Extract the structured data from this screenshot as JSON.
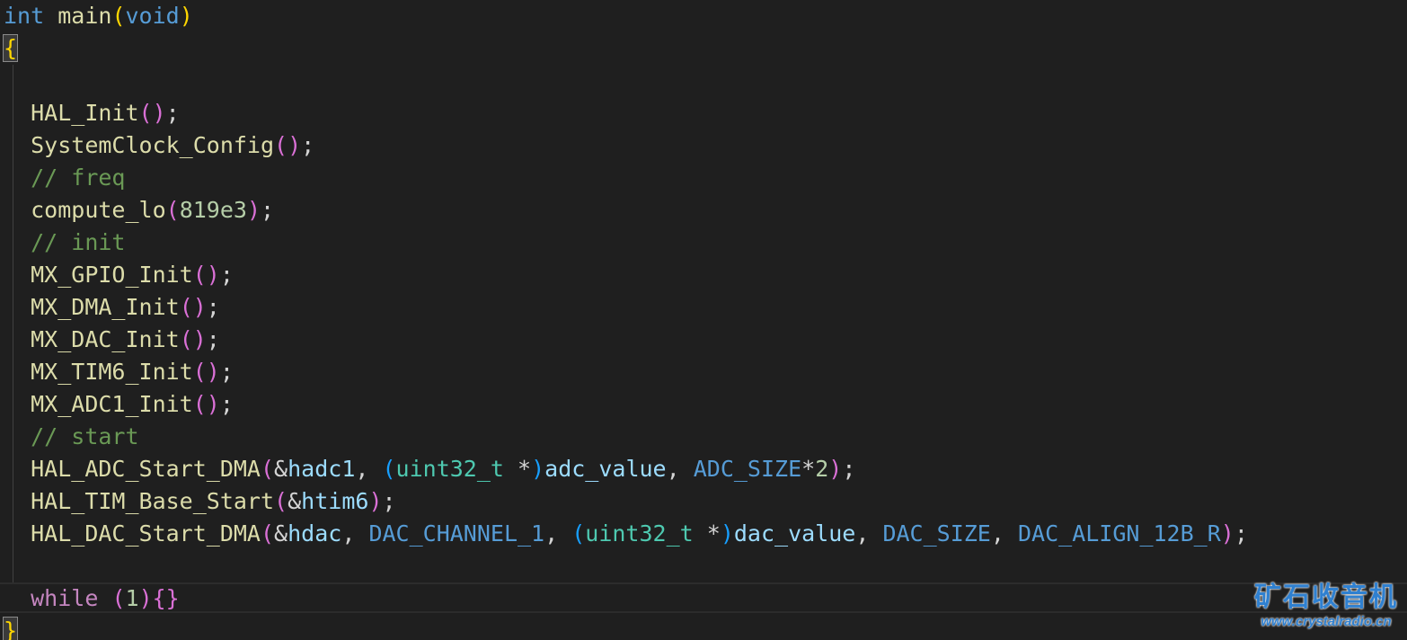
{
  "editor": {
    "theme_colors": {
      "background": "#1f1f1f",
      "keyword": "#569cd6",
      "function": "#dcdcaa",
      "comment": "#6a9955",
      "number": "#b5cea8",
      "type": "#4ec9b0",
      "variable": "#9cdcfe",
      "control": "#c586c0",
      "bracket_level1": "#ffd700",
      "bracket_level2": "#da70d6",
      "bracket_level3": "#179fff"
    },
    "lines": [
      [
        [
          "kw",
          "int"
        ],
        [
          "pu",
          " "
        ],
        [
          "fn",
          "main"
        ],
        [
          "br1",
          "("
        ],
        [
          "kw",
          "void"
        ],
        [
          "br1",
          ")"
        ]
      ],
      [
        [
          "br1hl",
          "{"
        ]
      ],
      [],
      [
        [
          "pu",
          "  "
        ],
        [
          "fn",
          "HAL_Init"
        ],
        [
          "br2",
          "()"
        ],
        [
          "pu",
          ";"
        ]
      ],
      [
        [
          "pu",
          "  "
        ],
        [
          "fn",
          "SystemClock_Config"
        ],
        [
          "br2",
          "()"
        ],
        [
          "pu",
          ";"
        ]
      ],
      [
        [
          "pu",
          "  "
        ],
        [
          "cm",
          "// freq"
        ]
      ],
      [
        [
          "pu",
          "  "
        ],
        [
          "fn",
          "compute_lo"
        ],
        [
          "br2",
          "("
        ],
        [
          "nu",
          "819e3"
        ],
        [
          "br2",
          ")"
        ],
        [
          "pu",
          ";"
        ]
      ],
      [
        [
          "pu",
          "  "
        ],
        [
          "cm",
          "// init"
        ]
      ],
      [
        [
          "pu",
          "  "
        ],
        [
          "fn",
          "MX_GPIO_Init"
        ],
        [
          "br2",
          "()"
        ],
        [
          "pu",
          ";"
        ]
      ],
      [
        [
          "pu",
          "  "
        ],
        [
          "fn",
          "MX_DMA_Init"
        ],
        [
          "br2",
          "()"
        ],
        [
          "pu",
          ";"
        ]
      ],
      [
        [
          "pu",
          "  "
        ],
        [
          "fn",
          "MX_DAC_Init"
        ],
        [
          "br2",
          "()"
        ],
        [
          "pu",
          ";"
        ]
      ],
      [
        [
          "pu",
          "  "
        ],
        [
          "fn",
          "MX_TIM6_Init"
        ],
        [
          "br2",
          "()"
        ],
        [
          "pu",
          ";"
        ]
      ],
      [
        [
          "pu",
          "  "
        ],
        [
          "fn",
          "MX_ADC1_Init"
        ],
        [
          "br2",
          "()"
        ],
        [
          "pu",
          ";"
        ]
      ],
      [
        [
          "pu",
          "  "
        ],
        [
          "cm",
          "// start"
        ]
      ],
      [
        [
          "pu",
          "  "
        ],
        [
          "fn",
          "HAL_ADC_Start_DMA"
        ],
        [
          "br2",
          "("
        ],
        [
          "pu",
          "&"
        ],
        [
          "va",
          "hadc1"
        ],
        [
          "pu",
          ", "
        ],
        [
          "br3",
          "("
        ],
        [
          "ty",
          "uint32_t"
        ],
        [
          "pu",
          " *"
        ],
        [
          "br3",
          ")"
        ],
        [
          "va",
          "adc_value"
        ],
        [
          "pu",
          ", "
        ],
        [
          "ma",
          "ADC_SIZE"
        ],
        [
          "pu",
          "*"
        ],
        [
          "nu",
          "2"
        ],
        [
          "br2",
          ")"
        ],
        [
          "pu",
          ";"
        ]
      ],
      [
        [
          "pu",
          "  "
        ],
        [
          "fn",
          "HAL_TIM_Base_Start"
        ],
        [
          "br2",
          "("
        ],
        [
          "pu",
          "&"
        ],
        [
          "va",
          "htim6"
        ],
        [
          "br2",
          ")"
        ],
        [
          "pu",
          ";"
        ]
      ],
      [
        [
          "pu",
          "  "
        ],
        [
          "fn",
          "HAL_DAC_Start_DMA"
        ],
        [
          "br2",
          "("
        ],
        [
          "pu",
          "&"
        ],
        [
          "va",
          "hdac"
        ],
        [
          "pu",
          ", "
        ],
        [
          "ma",
          "DAC_CHANNEL_1"
        ],
        [
          "pu",
          ", "
        ],
        [
          "br3",
          "("
        ],
        [
          "ty",
          "uint32_t"
        ],
        [
          "pu",
          " *"
        ],
        [
          "br3",
          ")"
        ],
        [
          "va",
          "dac_value"
        ],
        [
          "pu",
          ", "
        ],
        [
          "ma",
          "DAC_SIZE"
        ],
        [
          "pu",
          ", "
        ],
        [
          "ma",
          "DAC_ALIGN_12B_R"
        ],
        [
          "br2",
          ")"
        ],
        [
          "pu",
          ";"
        ]
      ],
      [],
      [
        [
          "pu",
          "  "
        ],
        [
          "ctl",
          "while"
        ],
        [
          "pu",
          " "
        ],
        [
          "br2",
          "("
        ],
        [
          "nu",
          "1"
        ],
        [
          "br2",
          ")"
        ],
        [
          "br2",
          "{}"
        ]
      ],
      [
        [
          "br1hl",
          "}"
        ]
      ]
    ]
  },
  "watermark": {
    "title": "矿石收音机",
    "url": "www.crystalradio.cn"
  }
}
